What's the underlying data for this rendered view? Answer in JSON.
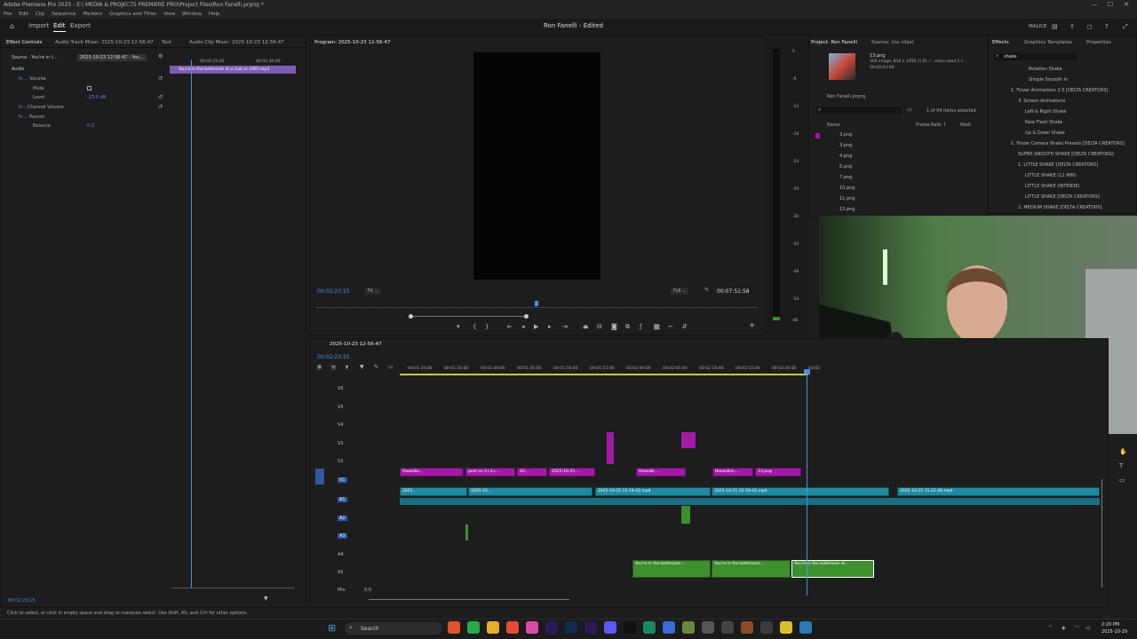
{
  "window": {
    "title": "Adobe Premiere Pro 2025 - E:\\ MEDIA & PROJECTS PREMIERE PRO\\Project Files\\Ron Fanelli.prproj *",
    "controls": [
      "—",
      "☐",
      "✕"
    ]
  },
  "menu": [
    "File",
    "Edit",
    "Clip",
    "Sequence",
    "Markers",
    "Graphics and Titles",
    "View",
    "Window",
    "Help"
  ],
  "header": {
    "workspaces": [
      "Import",
      "Edit",
      "Export"
    ],
    "active_workspace": "Edit",
    "project_title": "Ron Fanelli - Edited",
    "user": "MALICE"
  },
  "effect_controls": {
    "tabs": [
      "Effect Controls",
      "Audio Track Mixer: 2025-10-23 12-56-47",
      "Text",
      "Audio Clip Mixer: 2025-10-23 12-56-47"
    ],
    "source_label": "Source - You're in t...",
    "sequence_label": "2025-10-23 12-56-47 - You...",
    "section": "Audio",
    "rows": [
      {
        "label": "Volume",
        "value": ""
      },
      {
        "label": "Mute",
        "value": ""
      },
      {
        "label": "Level",
        "value": "-23.0 dB"
      },
      {
        "label": "Channel Volume",
        "value": ""
      },
      {
        "label": "Panner",
        "value": ""
      },
      {
        "label": "Balance",
        "value": "0.0"
      }
    ],
    "ruler": [
      "00:02:25:00",
      "00:02:30:00"
    ],
    "clip_name": "You're in the bathroom at a club in 2007.mp3",
    "timecode": "00:02:23:15"
  },
  "program": {
    "tab": "Program: 2025-10-23 12-56-47",
    "timecode": "00:02:23:15",
    "fit": "Fit",
    "quality": "Full",
    "duration": "00:07:51:58"
  },
  "meters": [
    "0",
    "-6",
    "-12",
    "-18",
    "-24",
    "-30",
    "-36",
    "-42",
    "-48",
    "-54",
    "dB"
  ],
  "project": {
    "tabs": [
      "Project: Ron Fanelli",
      "Source: (no clips)"
    ],
    "thumb_name": "13.png",
    "thumb_info": "Still Image, 816 x 1456 (1.0)  ✓, video used 1 t...",
    "thumb_dur": "00:00:03:00",
    "file": "Ron Fanelli.prproj",
    "selection": "1 of 94 items selected",
    "columns": [
      "Name",
      "Frame Rate ↑",
      "Medi"
    ],
    "items": [
      "3.png",
      "3.png",
      "4.png",
      "6.png",
      "7.png",
      "10.png",
      "11.png",
      "12.png"
    ]
  },
  "effects": {
    "tabs": [
      "Effects",
      "Graphics Templates",
      "Properties"
    ],
    "search": "shake",
    "items": [
      "Rotation Shake",
      "Simple Smooth In",
      "1. Finzar Animations 2.0 [DELTA CREATORS]",
      "3. Screen Animations",
      "Left & Right Shake",
      "New Flash Shake",
      "Up & Down Shake",
      "1. Finzar Camera Shake Presets [DELTA CREATORS]",
      "SUPER SMOOTH SHAKE [DELTA CREATORS]",
      "1. LITTLE SHAKE [DELTA CREATORS]",
      "LITTLE SHAKE (12 MIN)",
      "LITTLE SHAKE (INTENSE)",
      "LITTLE SHAKE [DELTA CREATORS]",
      "2. MEDIUM SHAKE [DELTA CREATORS]"
    ]
  },
  "timeline": {
    "tab": "2025-10-23 12-56-47",
    "timecode": "00:02:23:15",
    "ruler": [
      "00:01:30:00",
      "00:01:35:00",
      "00:01:40:00",
      "00:01:45:00",
      "00:01:50:00",
      "00:01:55:00",
      "00:02:00:00",
      "00:02:05:00",
      "00:02:10:00",
      "00:02:15:00",
      "00:02:20:00",
      "00:02"
    ],
    "video_tracks": [
      "V6",
      "V5",
      "V4",
      "V3",
      "V2",
      "V1"
    ],
    "audio_tracks": [
      "A1",
      "A2",
      "A3",
      "A4",
      "A5"
    ],
    "mix": "Mix",
    "mix_value": "0.0",
    "clips": {
      "v1a": "thewalki...",
      "v1b": "post on 2+2=...",
      "v1c": "20...",
      "v1d": "2025-10-25...",
      "v1e": "thewalk...",
      "v1f": "thewalkin...",
      "v1g": "13.png",
      "a1a": "2025...",
      "a1b": "2025-10...",
      "a1c": "2025-10-25 15-19-42.mp4",
      "a1d": "2025-10-25 15-19-42.mp4",
      "a1e": "2025-10-25 15-22-28.mp4",
      "a5a": "You're in the bathroom...",
      "a5b": "You're in the bathroom...",
      "a5c": "You're in the bathroom at..."
    }
  },
  "status": "Click to select, or click in empty space and drag to marquee select. Use Shift, Alt, and Ctrl for other options.",
  "taskbar": {
    "search": "Search",
    "time": "2:20 PM",
    "date": "2025-10-29"
  },
  "colors": {
    "playhead": "#4a8fe0",
    "video_clip": "#a21aa6",
    "audio_clip": "#1f8aa0",
    "music_clip": "#3e8f2e"
  }
}
